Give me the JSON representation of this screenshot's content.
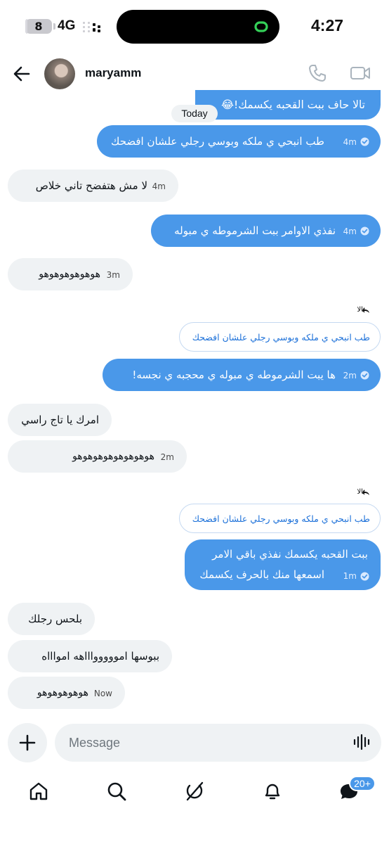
{
  "status_bar": {
    "battery_level": "8",
    "battery_fraction": 0.08,
    "network": "4G",
    "time": "4:27",
    "signal_icon": "signal-bars-icon",
    "island_icon": "link-icon"
  },
  "header": {
    "username": "maryamm",
    "back_icon": "back-arrow-icon",
    "call_icon": "phone-icon",
    "video_icon": "video-camera-icon"
  },
  "day_divider": "Today",
  "messages": [
    {
      "direction": "out",
      "text": "تالا حاف ببت القحبه يكسمك!😂",
      "time": ""
    },
    {
      "direction": "out",
      "text": "طب انبحي ي ملكه وبوسي رجلي علشان افضحك",
      "time": "4m"
    },
    {
      "direction": "in",
      "text": "لا مش هتفضح تاني خلاص",
      "time": "4m"
    },
    {
      "direction": "out",
      "text": "نفذي الاوامر ببت الشرموطه ي مبوله",
      "time": "4m"
    },
    {
      "direction": "in",
      "text": "هوهوهوهوهوهو",
      "time": "3m"
    },
    {
      "direction": "out",
      "text": "ها يبت الشرموطه ي مبوله ي محجبه ي نجسه!",
      "time": "2m"
    },
    {
      "direction": "in",
      "text": "امرك يا تاج راسي",
      "time": ""
    },
    {
      "direction": "in",
      "text": "هوهوهوهوهوهوهوهو",
      "time": "2m"
    },
    {
      "direction": "out",
      "text_line1": "ببت القحبه يكسمك نفذي باقي الامر",
      "text_line2": "اسمعها منك بالحرف يكسمك",
      "time": "1m"
    },
    {
      "direction": "in",
      "text": "بلحس رجلك",
      "time": ""
    },
    {
      "direction": "in",
      "text": "ببوسها امووووواااهه امواااه",
      "time": ""
    },
    {
      "direction": "in",
      "text": "هوهوهوهوهو",
      "time": "Now"
    }
  ],
  "replies": [
    {
      "label": "تالا",
      "quoted": "طب انبحي ي ملكه وبوسي رجلي علشان افضحك"
    },
    {
      "label": "تالا",
      "quoted": "طب انبحي ي ملكه وبوسي رجلي علشان افضحك"
    }
  ],
  "composer": {
    "placeholder": "Message",
    "plus_icon": "plus-icon",
    "voice_icon": "voice-waveform-icon"
  },
  "bottom_nav": {
    "items": [
      "home-icon",
      "search-icon",
      "grok-icon",
      "notifications-icon",
      "messages-icon"
    ],
    "messages_badge": "20+"
  },
  "colors": {
    "outgoing_bubble": "#4a98e9",
    "incoming_bubble": "#eff2f4",
    "quote_text": "#1d71d9"
  }
}
